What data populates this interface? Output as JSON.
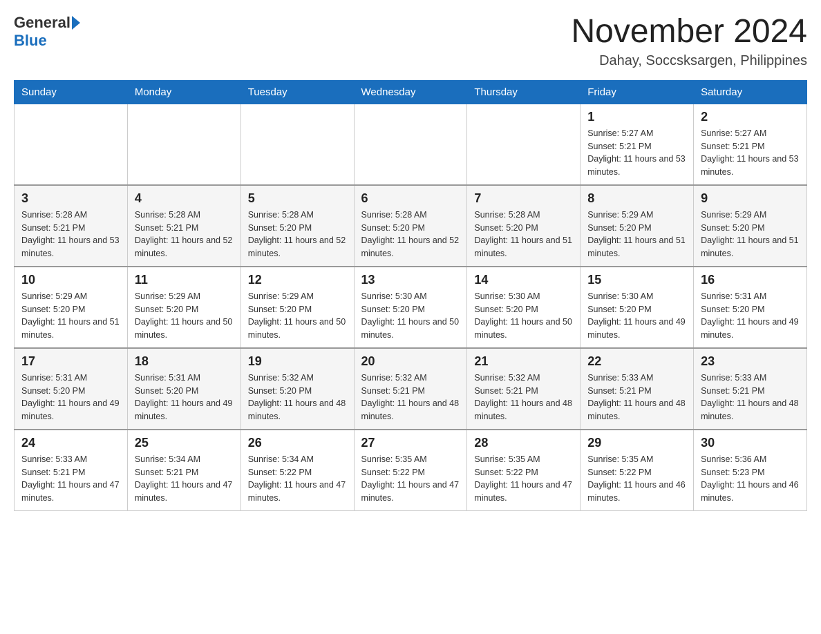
{
  "logo": {
    "text_general": "General",
    "text_blue": "Blue"
  },
  "header": {
    "title": "November 2024",
    "subtitle": "Dahay, Soccsksargen, Philippines"
  },
  "days_of_week": [
    "Sunday",
    "Monday",
    "Tuesday",
    "Wednesday",
    "Thursday",
    "Friday",
    "Saturday"
  ],
  "weeks": [
    {
      "days": [
        {
          "number": "",
          "sunrise": "",
          "sunset": "",
          "daylight": "",
          "empty": true
        },
        {
          "number": "",
          "sunrise": "",
          "sunset": "",
          "daylight": "",
          "empty": true
        },
        {
          "number": "",
          "sunrise": "",
          "sunset": "",
          "daylight": "",
          "empty": true
        },
        {
          "number": "",
          "sunrise": "",
          "sunset": "",
          "daylight": "",
          "empty": true
        },
        {
          "number": "",
          "sunrise": "",
          "sunset": "",
          "daylight": "",
          "empty": true
        },
        {
          "number": "1",
          "sunrise": "Sunrise: 5:27 AM",
          "sunset": "Sunset: 5:21 PM",
          "daylight": "Daylight: 11 hours and 53 minutes.",
          "empty": false
        },
        {
          "number": "2",
          "sunrise": "Sunrise: 5:27 AM",
          "sunset": "Sunset: 5:21 PM",
          "daylight": "Daylight: 11 hours and 53 minutes.",
          "empty": false
        }
      ]
    },
    {
      "days": [
        {
          "number": "3",
          "sunrise": "Sunrise: 5:28 AM",
          "sunset": "Sunset: 5:21 PM",
          "daylight": "Daylight: 11 hours and 53 minutes.",
          "empty": false
        },
        {
          "number": "4",
          "sunrise": "Sunrise: 5:28 AM",
          "sunset": "Sunset: 5:21 PM",
          "daylight": "Daylight: 11 hours and 52 minutes.",
          "empty": false
        },
        {
          "number": "5",
          "sunrise": "Sunrise: 5:28 AM",
          "sunset": "Sunset: 5:20 PM",
          "daylight": "Daylight: 11 hours and 52 minutes.",
          "empty": false
        },
        {
          "number": "6",
          "sunrise": "Sunrise: 5:28 AM",
          "sunset": "Sunset: 5:20 PM",
          "daylight": "Daylight: 11 hours and 52 minutes.",
          "empty": false
        },
        {
          "number": "7",
          "sunrise": "Sunrise: 5:28 AM",
          "sunset": "Sunset: 5:20 PM",
          "daylight": "Daylight: 11 hours and 51 minutes.",
          "empty": false
        },
        {
          "number": "8",
          "sunrise": "Sunrise: 5:29 AM",
          "sunset": "Sunset: 5:20 PM",
          "daylight": "Daylight: 11 hours and 51 minutes.",
          "empty": false
        },
        {
          "number": "9",
          "sunrise": "Sunrise: 5:29 AM",
          "sunset": "Sunset: 5:20 PM",
          "daylight": "Daylight: 11 hours and 51 minutes.",
          "empty": false
        }
      ]
    },
    {
      "days": [
        {
          "number": "10",
          "sunrise": "Sunrise: 5:29 AM",
          "sunset": "Sunset: 5:20 PM",
          "daylight": "Daylight: 11 hours and 51 minutes.",
          "empty": false
        },
        {
          "number": "11",
          "sunrise": "Sunrise: 5:29 AM",
          "sunset": "Sunset: 5:20 PM",
          "daylight": "Daylight: 11 hours and 50 minutes.",
          "empty": false
        },
        {
          "number": "12",
          "sunrise": "Sunrise: 5:29 AM",
          "sunset": "Sunset: 5:20 PM",
          "daylight": "Daylight: 11 hours and 50 minutes.",
          "empty": false
        },
        {
          "number": "13",
          "sunrise": "Sunrise: 5:30 AM",
          "sunset": "Sunset: 5:20 PM",
          "daylight": "Daylight: 11 hours and 50 minutes.",
          "empty": false
        },
        {
          "number": "14",
          "sunrise": "Sunrise: 5:30 AM",
          "sunset": "Sunset: 5:20 PM",
          "daylight": "Daylight: 11 hours and 50 minutes.",
          "empty": false
        },
        {
          "number": "15",
          "sunrise": "Sunrise: 5:30 AM",
          "sunset": "Sunset: 5:20 PM",
          "daylight": "Daylight: 11 hours and 49 minutes.",
          "empty": false
        },
        {
          "number": "16",
          "sunrise": "Sunrise: 5:31 AM",
          "sunset": "Sunset: 5:20 PM",
          "daylight": "Daylight: 11 hours and 49 minutes.",
          "empty": false
        }
      ]
    },
    {
      "days": [
        {
          "number": "17",
          "sunrise": "Sunrise: 5:31 AM",
          "sunset": "Sunset: 5:20 PM",
          "daylight": "Daylight: 11 hours and 49 minutes.",
          "empty": false
        },
        {
          "number": "18",
          "sunrise": "Sunrise: 5:31 AM",
          "sunset": "Sunset: 5:20 PM",
          "daylight": "Daylight: 11 hours and 49 minutes.",
          "empty": false
        },
        {
          "number": "19",
          "sunrise": "Sunrise: 5:32 AM",
          "sunset": "Sunset: 5:20 PM",
          "daylight": "Daylight: 11 hours and 48 minutes.",
          "empty": false
        },
        {
          "number": "20",
          "sunrise": "Sunrise: 5:32 AM",
          "sunset": "Sunset: 5:21 PM",
          "daylight": "Daylight: 11 hours and 48 minutes.",
          "empty": false
        },
        {
          "number": "21",
          "sunrise": "Sunrise: 5:32 AM",
          "sunset": "Sunset: 5:21 PM",
          "daylight": "Daylight: 11 hours and 48 minutes.",
          "empty": false
        },
        {
          "number": "22",
          "sunrise": "Sunrise: 5:33 AM",
          "sunset": "Sunset: 5:21 PM",
          "daylight": "Daylight: 11 hours and 48 minutes.",
          "empty": false
        },
        {
          "number": "23",
          "sunrise": "Sunrise: 5:33 AM",
          "sunset": "Sunset: 5:21 PM",
          "daylight": "Daylight: 11 hours and 48 minutes.",
          "empty": false
        }
      ]
    },
    {
      "days": [
        {
          "number": "24",
          "sunrise": "Sunrise: 5:33 AM",
          "sunset": "Sunset: 5:21 PM",
          "daylight": "Daylight: 11 hours and 47 minutes.",
          "empty": false
        },
        {
          "number": "25",
          "sunrise": "Sunrise: 5:34 AM",
          "sunset": "Sunset: 5:21 PM",
          "daylight": "Daylight: 11 hours and 47 minutes.",
          "empty": false
        },
        {
          "number": "26",
          "sunrise": "Sunrise: 5:34 AM",
          "sunset": "Sunset: 5:22 PM",
          "daylight": "Daylight: 11 hours and 47 minutes.",
          "empty": false
        },
        {
          "number": "27",
          "sunrise": "Sunrise: 5:35 AM",
          "sunset": "Sunset: 5:22 PM",
          "daylight": "Daylight: 11 hours and 47 minutes.",
          "empty": false
        },
        {
          "number": "28",
          "sunrise": "Sunrise: 5:35 AM",
          "sunset": "Sunset: 5:22 PM",
          "daylight": "Daylight: 11 hours and 47 minutes.",
          "empty": false
        },
        {
          "number": "29",
          "sunrise": "Sunrise: 5:35 AM",
          "sunset": "Sunset: 5:22 PM",
          "daylight": "Daylight: 11 hours and 46 minutes.",
          "empty": false
        },
        {
          "number": "30",
          "sunrise": "Sunrise: 5:36 AM",
          "sunset": "Sunset: 5:23 PM",
          "daylight": "Daylight: 11 hours and 46 minutes.",
          "empty": false
        }
      ]
    }
  ]
}
